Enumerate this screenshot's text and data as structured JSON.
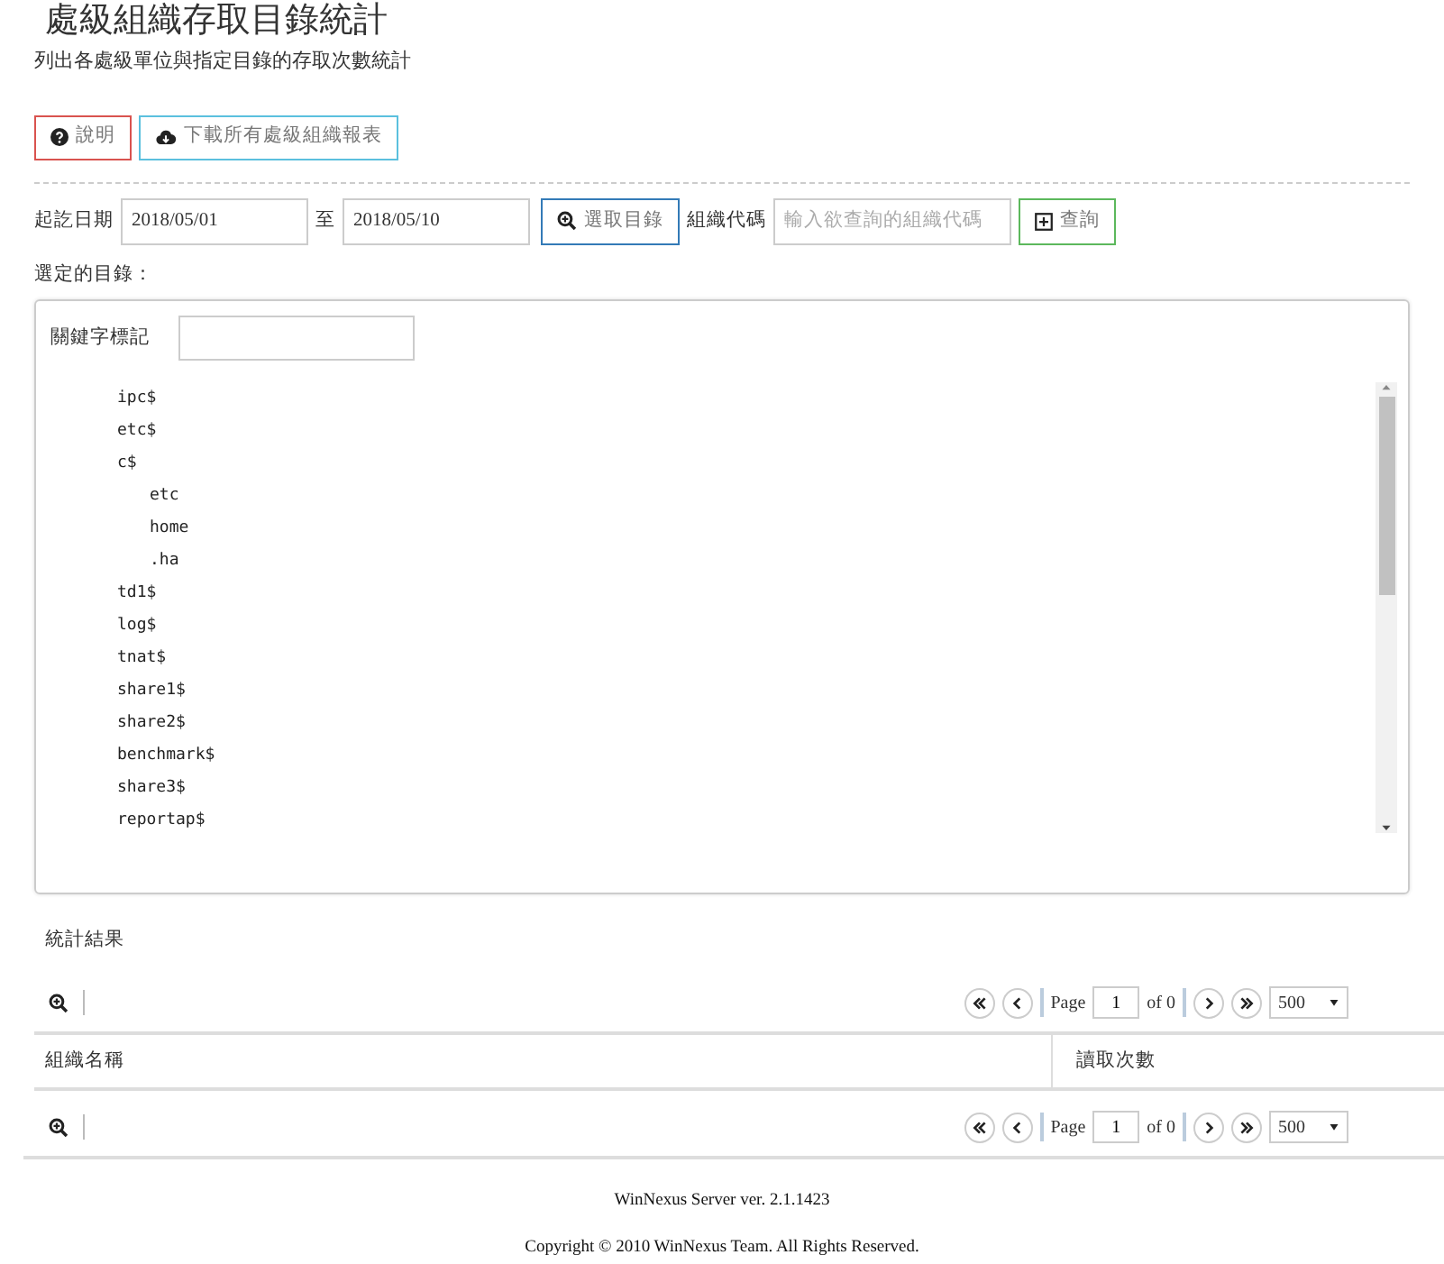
{
  "page": {
    "title": "處級組織存取目錄統計",
    "subtitle": "列出各處級單位與指定目錄的存取次數統計"
  },
  "buttons": [
    {
      "label": "說明",
      "kind": "help"
    },
    {
      "label": "下載所有處級組織報表",
      "kind": "download"
    }
  ],
  "filter": {
    "date_label": "起訖日期",
    "start_date": "2018/05/01",
    "to_label": "至",
    "end_date": "2018/05/10",
    "select_button": "選取目錄",
    "org_label": "組織代碼",
    "org_placeholder": "輸入欲查詢的組織代碼",
    "query_button": "查詢"
  },
  "selected_label": "選定的目錄：",
  "directory_panel": {
    "keyword_label": "關鍵字標記",
    "tree": [
      {
        "label": "ipc$"
      },
      {
        "label": "etc$"
      },
      {
        "label": "c$",
        "children": [
          {
            "label": "etc"
          },
          {
            "label": "home"
          },
          {
            "label": ".ha"
          }
        ]
      },
      {
        "label": "td1$"
      },
      {
        "label": "log$"
      },
      {
        "label": "tnat$"
      },
      {
        "label": "share1$"
      },
      {
        "label": "share2$"
      },
      {
        "label": "benchmark$"
      },
      {
        "label": "share3$"
      },
      {
        "label": "reportap$"
      }
    ]
  },
  "results": {
    "title": "統計結果",
    "columns": [
      "組織名稱",
      "讀取次數"
    ],
    "pagers": [
      {
        "page_label": "Page",
        "page": "1",
        "of_label": "of 0",
        "page_size": "500"
      },
      {
        "page_label": "Page",
        "page": "1",
        "of_label": "of 0",
        "page_size": "500"
      }
    ]
  },
  "footer": {
    "version": "WinNexus Server ver. 2.1.1423",
    "copyright": "Copyright © 2010 WinNexus Team. All Rights Reserved."
  }
}
